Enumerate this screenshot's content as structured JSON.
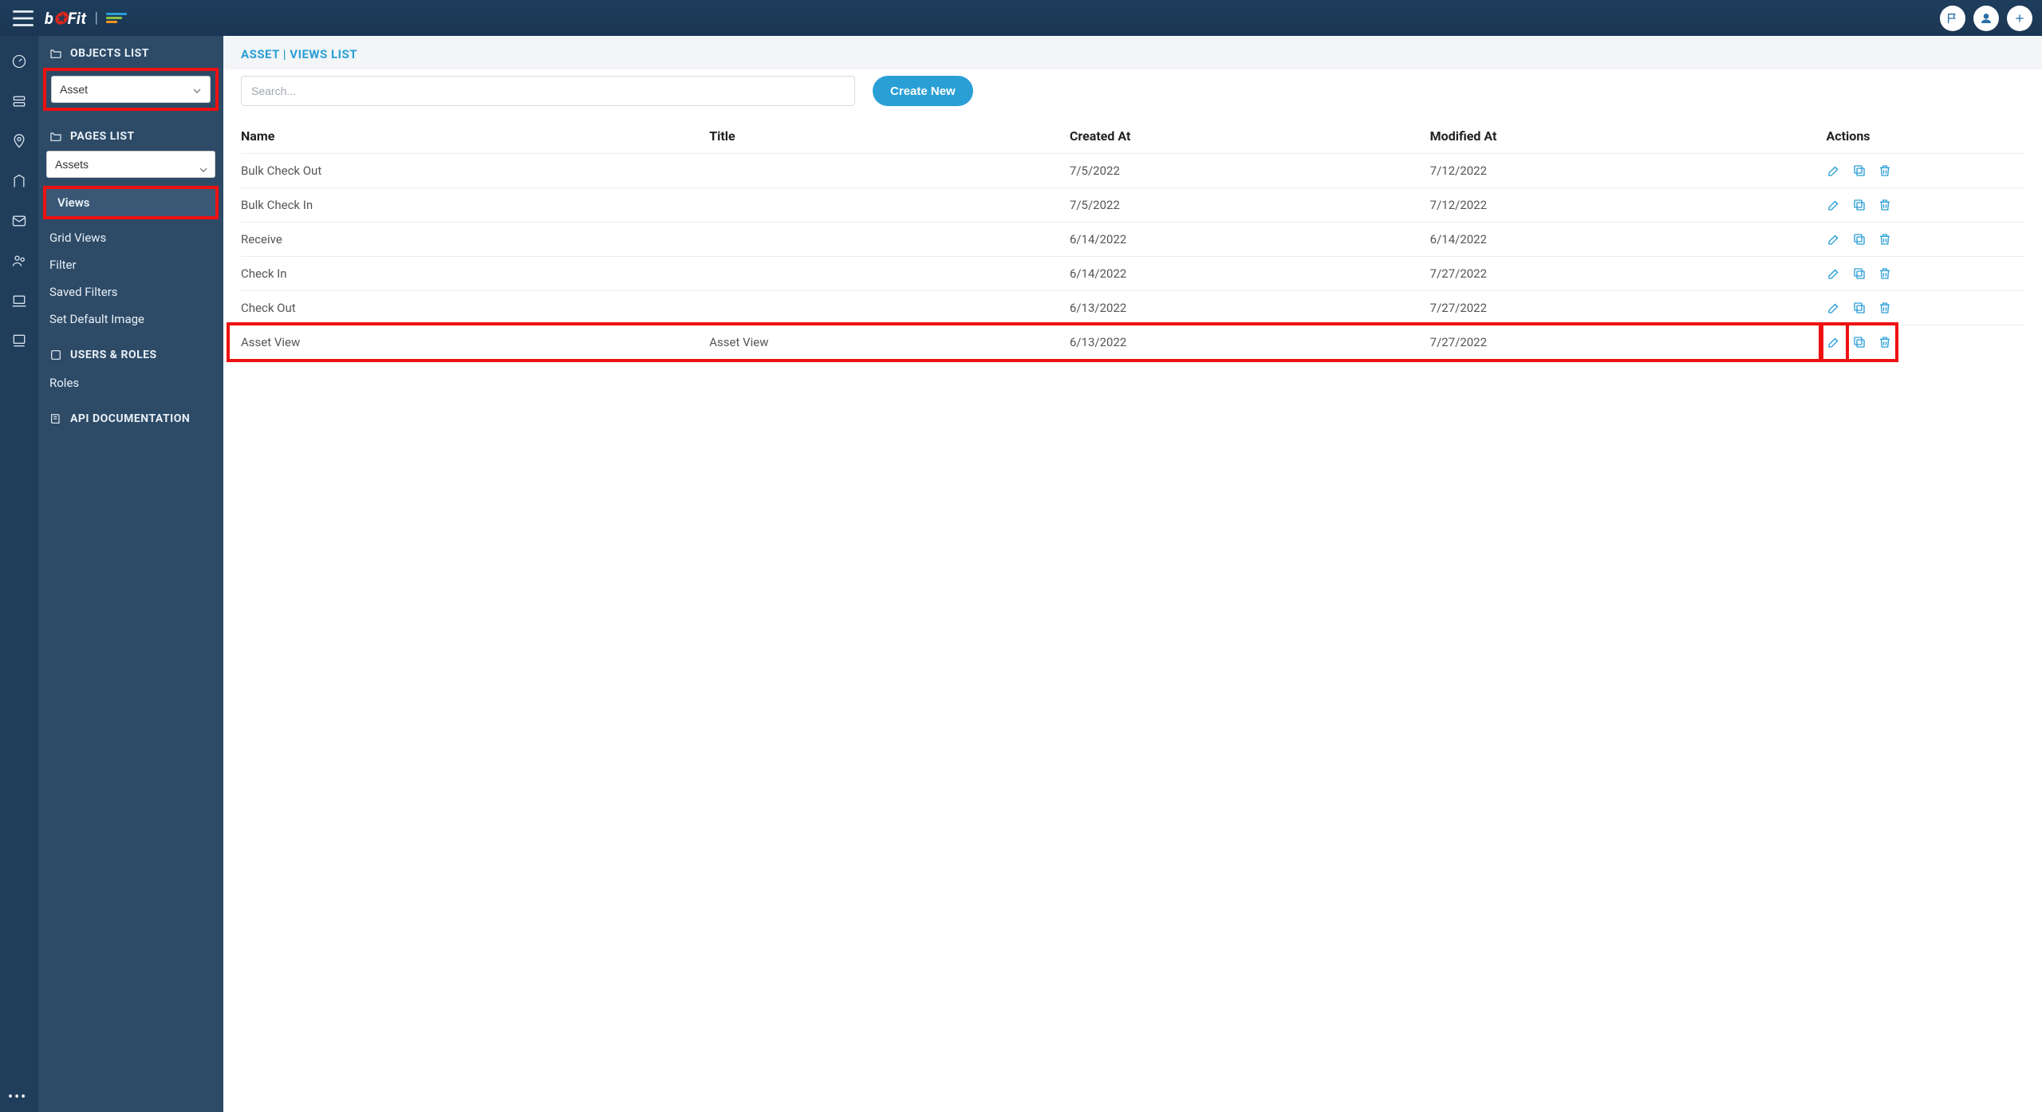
{
  "header": {
    "logo_prefix": "b",
    "logo_mid": "✪",
    "logo_suffix": "Fit"
  },
  "sidebar": {
    "sections": {
      "objects": "OBJECTS LIST",
      "pages": "PAGES LIST",
      "users": "USERS & ROLES",
      "api": "API DOCUMENTATION"
    },
    "object_select": "Asset",
    "page_select": "Assets",
    "nav": {
      "views": "Views",
      "grid_views": "Grid Views",
      "filter": "Filter",
      "saved_filters": "Saved Filters",
      "default_image": "Set Default Image"
    },
    "roles": "Roles"
  },
  "content": {
    "breadcrumb": "ASSET | VIEWS LIST",
    "search_placeholder": "Search...",
    "create_btn": "Create New",
    "columns": {
      "name": "Name",
      "title": "Title",
      "created": "Created At",
      "modified": "Modified At",
      "actions": "Actions"
    },
    "rows": [
      {
        "name": "Bulk Check Out",
        "title": "",
        "created": "7/5/2022",
        "modified": "7/12/2022"
      },
      {
        "name": "Bulk Check In",
        "title": "",
        "created": "7/5/2022",
        "modified": "7/12/2022"
      },
      {
        "name": "Receive",
        "title": "",
        "created": "6/14/2022",
        "modified": "6/14/2022"
      },
      {
        "name": "Check In",
        "title": "",
        "created": "6/14/2022",
        "modified": "7/27/2022"
      },
      {
        "name": "Check Out",
        "title": "",
        "created": "6/13/2022",
        "modified": "7/27/2022"
      },
      {
        "name": "Asset View",
        "title": "Asset View",
        "created": "6/13/2022",
        "modified": "7/27/2022",
        "hl": true
      }
    ]
  }
}
